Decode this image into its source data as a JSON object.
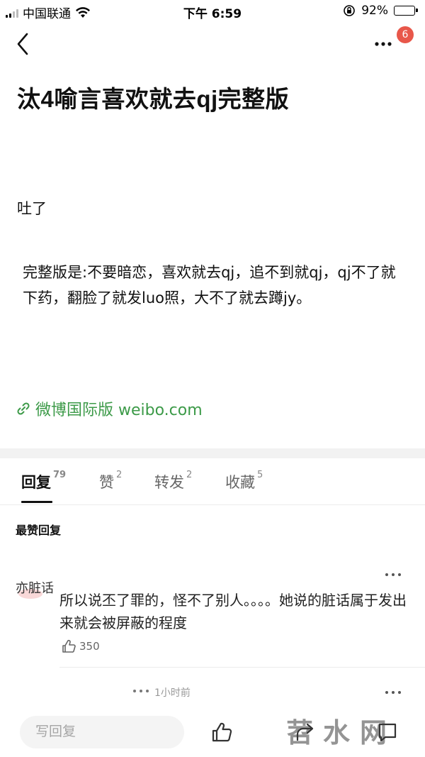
{
  "status_bar": {
    "carrier": "中国联通",
    "time": "下午 6:59",
    "battery_percent": "92%",
    "battery_level": 0.92
  },
  "nav": {
    "badge_count": "6"
  },
  "post": {
    "title": "汰4喻言喜欢就去qj完整版",
    "line1": "吐了",
    "body": "完整版是:不要暗恋，喜欢就去qj，追不到就qj，qj不了就下药，翻脸了就发luo照，大不了就去蹲jy。",
    "link_text": "微博国际版 weibo.com",
    "link_color": "#3c9a48"
  },
  "tabs": [
    {
      "label": "回复",
      "count": "79"
    },
    {
      "label": "赞",
      "count": "2"
    },
    {
      "label": "转发",
      "count": "2"
    },
    {
      "label": "收藏",
      "count": "5"
    }
  ],
  "replies": {
    "section_title": "最赞回复",
    "first": {
      "user_fragment": "亦脏话",
      "text": "所以说丕了罪的，怪不了别人。。。。她说的脏话属于发出来就会被屏蔽的程度",
      "likes": "350"
    },
    "second": {
      "time": "1小时前"
    }
  },
  "bottom_bar": {
    "compose_placeholder": "写回复",
    "watermark": "苕水网"
  }
}
